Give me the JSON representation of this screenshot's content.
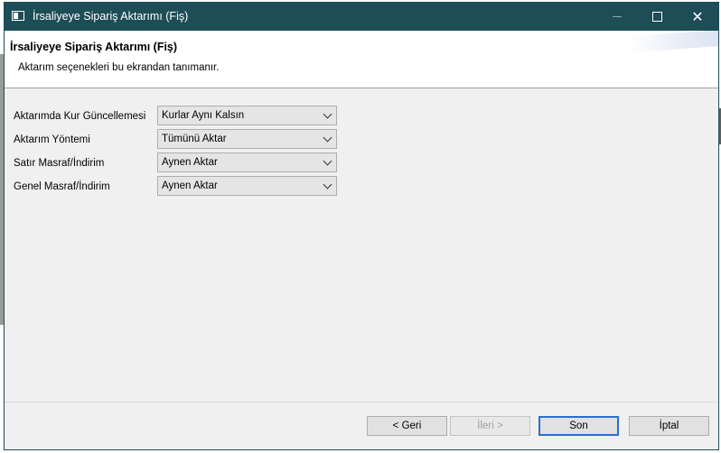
{
  "window": {
    "title": "İrsaliyeye Sipariş Aktarımı (Fiş)",
    "controls": {
      "minimize": "—",
      "maximize": "□",
      "close": "✕"
    }
  },
  "header": {
    "title": "İrsaliyeye Sipariş Aktarımı (Fiş)",
    "subtitle": "Aktarım seçenekleri bu ekrandan tanımanır."
  },
  "form": {
    "rows": [
      {
        "label": "Aktarımda Kur Güncellemesi",
        "value": "Kurlar Aynı Kalsın"
      },
      {
        "label": "Aktarım Yöntemi",
        "value": "Tümünü Aktar"
      },
      {
        "label": "Satır Masraf/İndirim",
        "value": "Aynen Aktar"
      },
      {
        "label": "Genel Masraf/İndirim",
        "value": "Aynen Aktar"
      }
    ]
  },
  "buttons": {
    "back": "< Geri",
    "next": "İleri >",
    "finish": "Son",
    "cancel": "İptal"
  }
}
